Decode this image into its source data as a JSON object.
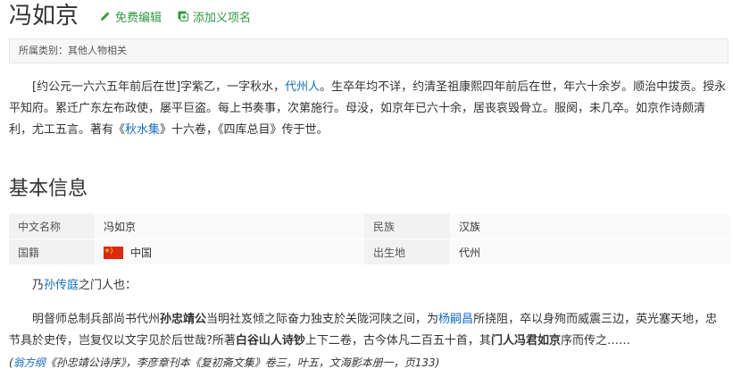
{
  "header": {
    "title": "冯如京",
    "edit_label": "免费编辑",
    "add_label": "添加义项名"
  },
  "category": {
    "text": "所属类别：其他人物相关"
  },
  "summary": {
    "s1": "[约公元一六六五年前后在世]字紫乙，一字秋水，",
    "s1_link": "代州人",
    "s2": "。生卒年均不详，约清圣祖康熙四年前后在世，年六十余岁。顺治中拔贡。授永平知府。累迁广东左布政使，屡平巨盗。每上书奏事，次第施行。母没，如京年已六十余，居丧哀毁骨立。服阕，未几卒。如京作诗颇清利，尤工五言。著有《",
    "s2_link": "秋水集",
    "s3": "》十六卷，《四库总目》传于世。"
  },
  "basic_info": {
    "title": "基本信息",
    "rows": [
      {
        "k1": "中文名称",
        "v1": "冯如京",
        "k2": "民族",
        "v2": "汉族"
      },
      {
        "k1": "国籍",
        "v1": "中国",
        "k2": "出生地",
        "v2": "代州"
      }
    ]
  },
  "para1": {
    "a": "乃",
    "link": "孙传庭",
    "b": "之门人也："
  },
  "para2": {
    "a": "明督师总制兵部尚书代州",
    "bold1": "孙忠靖公",
    "b": "当明社岌倾之际奋力独支於关陇河陕之间，为",
    "link1": "杨嗣昌",
    "c": "所挠阻，卒以身殉而威震三边，英光塞天地，忠节具於史传，岂复仅以文字见於后世哉?所著",
    "bold2": "白谷山人诗钞",
    "d": "上下二卷，古今体凡二百五十首，其",
    "bold3": "门人冯君如京",
    "e": "序而传之……",
    "src_open": "(",
    "src_link": "翁方纲",
    "src_rest": "《孙忠靖公诗序》，李彦章刊本《复初斋文集》卷三，叶五，文海影本册一，页133)"
  },
  "colors": {
    "link": "#136ec2",
    "action_green": "#2d9b3a",
    "flag_red": "#de2910",
    "flag_star": "#ffde00"
  },
  "icons": [
    "pencil-icon",
    "add-entry-icon",
    "china-flag-icon"
  ]
}
